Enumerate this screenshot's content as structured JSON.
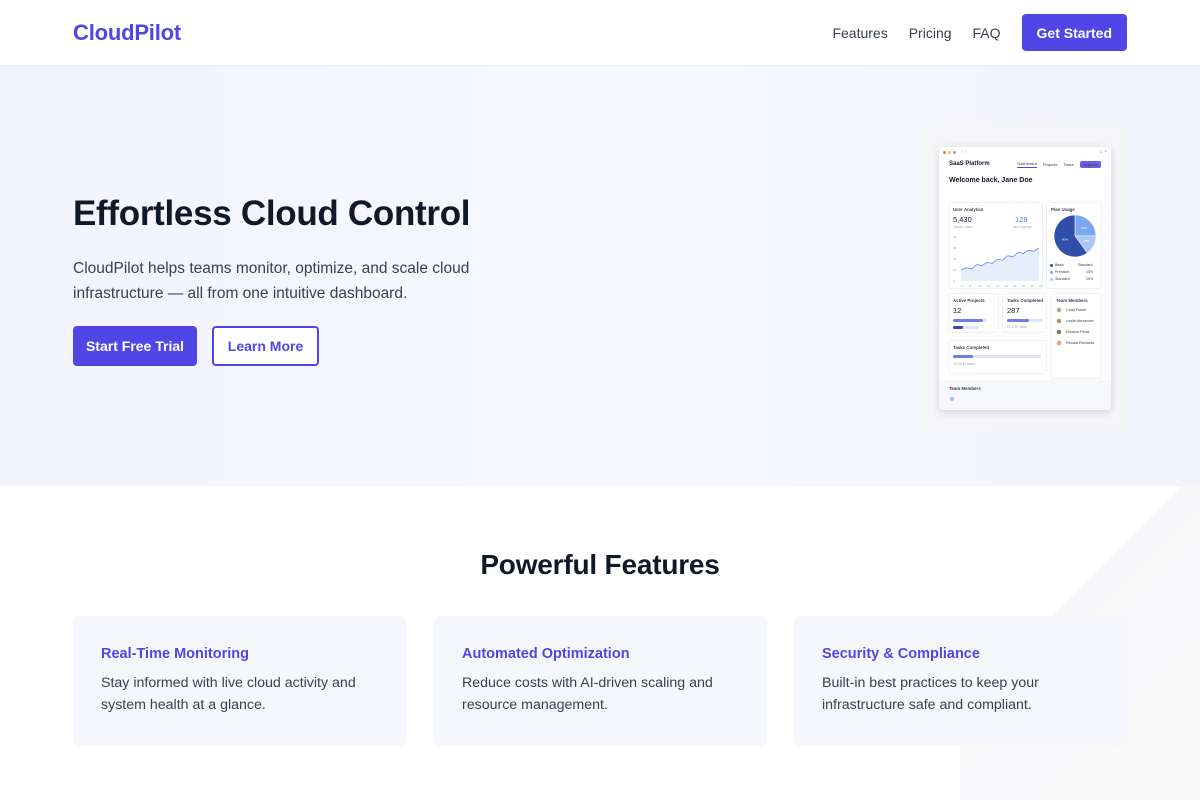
{
  "header": {
    "logo": "CloudPilot",
    "nav": [
      {
        "label": "Features"
      },
      {
        "label": "Pricing"
      },
      {
        "label": "FAQ"
      }
    ],
    "cta_label": "Get Started"
  },
  "hero": {
    "title": "Effortless Cloud Control",
    "text": "CloudPilot helps teams monitor, optimize, and scale cloud infrastructure — all from one intuitive dashboard.",
    "primary_label": "Start Free Trial",
    "secondary_label": "Learn More"
  },
  "mockup": {
    "brand": "SaaS Platform",
    "nav": [
      "Dashboard",
      "Projects",
      "Tasks"
    ],
    "upgrade_label": "Upgrade",
    "welcome": "Welcome back, Jane Doe",
    "analytics": {
      "title": "User Analytics",
      "users_value": "5,430",
      "users_label": "Today's Users",
      "signups_value": "128",
      "signups_label": "New Signups",
      "y_ticks": [
        "40",
        "30",
        "20",
        "10",
        "0"
      ],
      "x_ticks": [
        "6",
        "8",
        "10",
        "12",
        "14",
        "16",
        "18",
        "20",
        "22",
        "24"
      ],
      "series": [
        10,
        12,
        11,
        15,
        14,
        17,
        16,
        20,
        19,
        23,
        22,
        26,
        25,
        28,
        27,
        30
      ]
    },
    "plan_usage": {
      "title": "Plan Usage",
      "legend": [
        {
          "name": "Basic",
          "value": "Standard",
          "color": "#2f4fa8"
        },
        {
          "name": "Premium",
          "value": "15%",
          "color": "#7aa7ef"
        },
        {
          "name": "Standard",
          "value": "25%",
          "color": "#a9c6f5"
        }
      ],
      "slice_labels": [
        "25%",
        "15%",
        "60%"
      ]
    },
    "active_projects": {
      "title": "Active Projects",
      "value": "12"
    },
    "tasks_completed_small": {
      "title": "Tasks Completed",
      "value": "287",
      "sub": "22 of 87 tasks"
    },
    "team_members": {
      "title": "Team Members",
      "list": [
        "Cody Fisher",
        "Leslie Alexander",
        "Eleanor Pena",
        "Ronald Richards"
      ]
    },
    "tasks_completed_wide": {
      "title": "Tasks Completed",
      "sub": "22 out 87 tasks"
    },
    "footer_title": "Team Members"
  },
  "features": {
    "title": "Powerful Features",
    "items": [
      {
        "title": "Real-Time Monitoring",
        "text": "Stay informed with live cloud activity and system health at a glance."
      },
      {
        "title": "Automated Optimization",
        "text": "Reduce costs with AI-driven scaling and resource management."
      },
      {
        "title": "Security & Compliance",
        "text": "Built-in best practices to keep your infrastructure safe and compliant."
      }
    ]
  },
  "colors": {
    "accent": "#4f46e5",
    "hero_bg": "#f3f3ff",
    "card_bg": "#f6f7fd"
  }
}
